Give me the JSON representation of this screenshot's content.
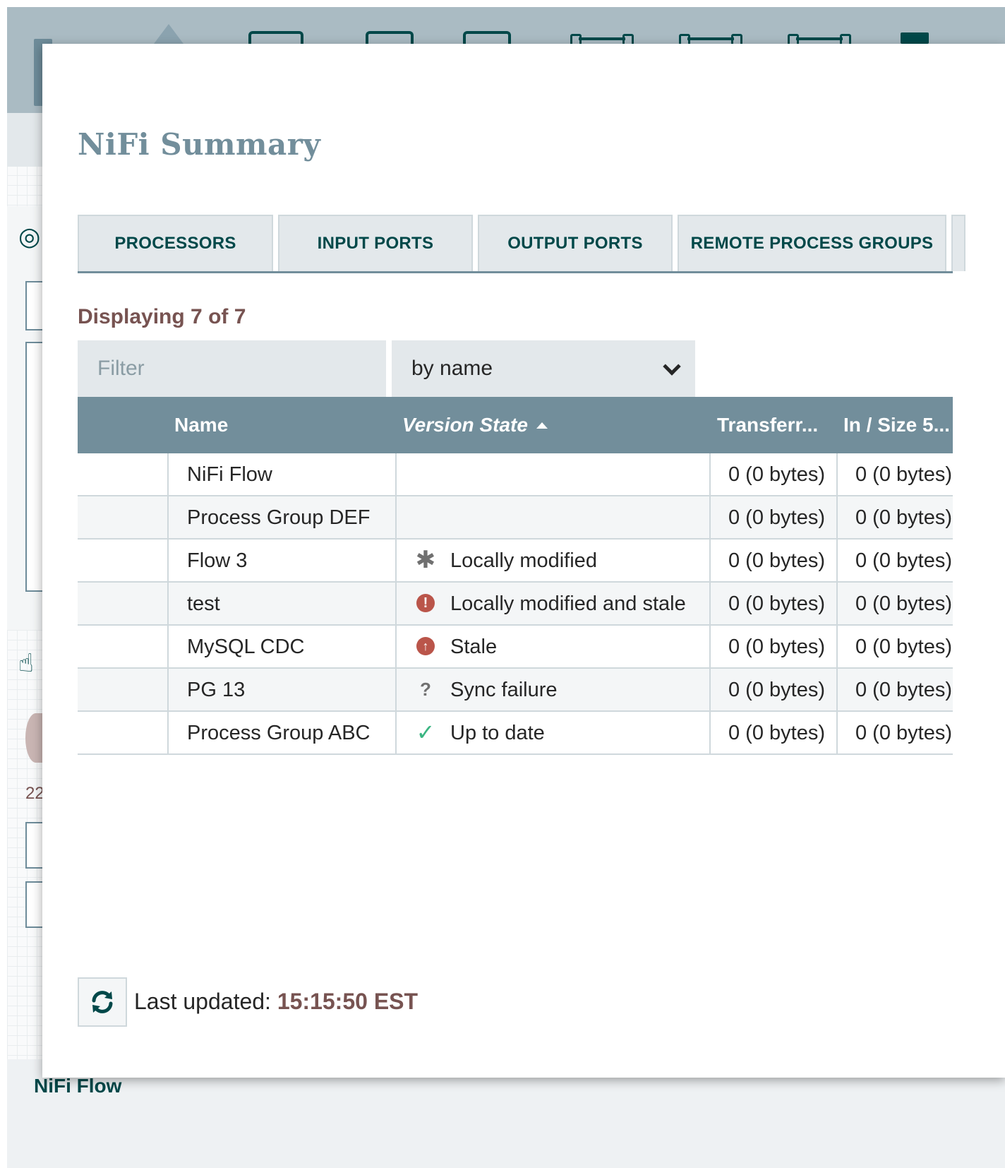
{
  "dialog": {
    "title": "NiFi Summary"
  },
  "tabs": [
    {
      "label": "PROCESSORS"
    },
    {
      "label": "INPUT PORTS"
    },
    {
      "label": "OUTPUT PORTS"
    },
    {
      "label": "REMOTE PROCESS GROUPS"
    }
  ],
  "status": {
    "prefix": "Displaying ",
    "count": "7 of 7"
  },
  "filter": {
    "placeholder": "Filter",
    "by_label": "by name"
  },
  "table": {
    "columns": {
      "name": "Name",
      "version_state": "Version State",
      "transferred": "Transferr...",
      "in_size": "In / Size 5..."
    },
    "rows": [
      {
        "name": "NiFi Flow",
        "version_icon": "",
        "version_state": "",
        "transferred": "0 (0 bytes)",
        "in_size": "0 (0 bytes)"
      },
      {
        "name": "Process Group DEF",
        "version_icon": "",
        "version_state": "",
        "transferred": "0 (0 bytes)",
        "in_size": "0 (0 bytes)"
      },
      {
        "name": "Flow 3",
        "version_icon": "asterisk-icon",
        "version_state": "Locally modified",
        "transferred": "0 (0 bytes)",
        "in_size": "0 (0 bytes)"
      },
      {
        "name": "test",
        "version_icon": "exclamation-circle-icon",
        "version_state": "Locally modified and stale",
        "transferred": "0 (0 bytes)",
        "in_size": "0 (0 bytes)"
      },
      {
        "name": "MySQL CDC",
        "version_icon": "arrow-up-circle-icon",
        "version_state": "Stale",
        "transferred": "0 (0 bytes)",
        "in_size": "0 (0 bytes)"
      },
      {
        "name": "PG 13",
        "version_icon": "question-icon",
        "version_state": "Sync failure",
        "transferred": "0 (0 bytes)",
        "in_size": "0 (0 bytes)"
      },
      {
        "name": "Process Group ABC",
        "version_icon": "checkmark-icon",
        "version_state": "Up to date",
        "transferred": "0 (0 bytes)",
        "in_size": "0 (0 bytes)"
      }
    ]
  },
  "footer": {
    "last_updated_label": "Last updated: ",
    "last_updated_time": "15:15:50 EST",
    "refresh_icon": "refresh-icon"
  },
  "background": {
    "breadcrumb": "NiFi Flow",
    "side_number": "22"
  },
  "colors": {
    "header": "#728e9b",
    "accent_text": "#775351",
    "dark_teal": "#004849",
    "error": "#ba554a",
    "success": "#3bb582"
  }
}
